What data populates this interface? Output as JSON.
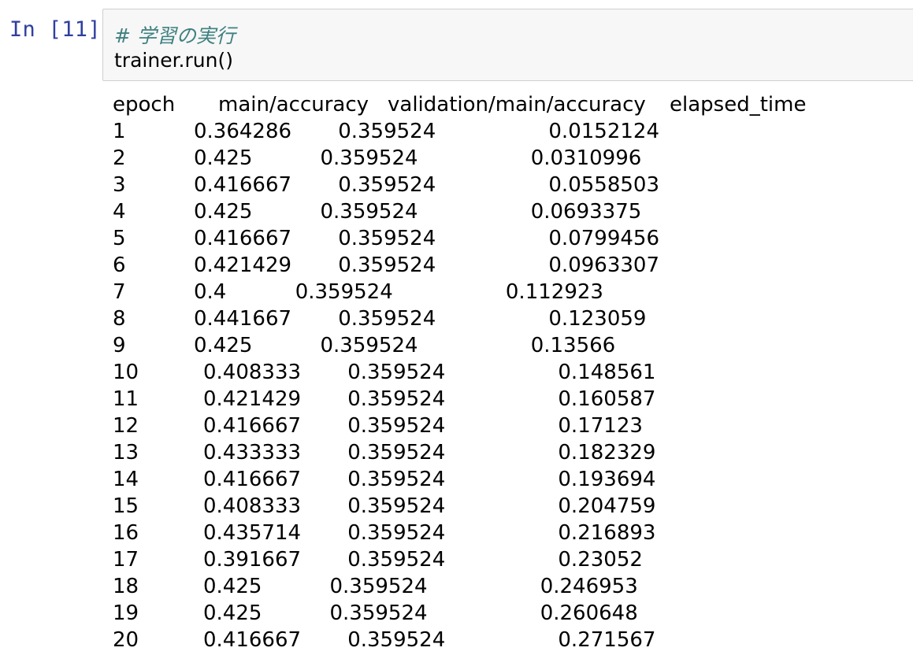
{
  "prompt": "In [11]:",
  "code": {
    "comment": "# 学習の実行",
    "line": "trainer.run()"
  },
  "output": {
    "headers": {
      "epoch": "epoch",
      "main_accuracy": "main/accuracy",
      "validation_accuracy": "validation/main/accuracy",
      "elapsed_time": "elapsed_time"
    },
    "rows": [
      {
        "epoch": "1",
        "main_accuracy": "0.364286",
        "validation_accuracy": "0.359524",
        "elapsed_time": "0.0152124"
      },
      {
        "epoch": "2",
        "main_accuracy": "0.425",
        "validation_accuracy": "0.359524",
        "elapsed_time": "0.0310996"
      },
      {
        "epoch": "3",
        "main_accuracy": "0.416667",
        "validation_accuracy": "0.359524",
        "elapsed_time": "0.0558503"
      },
      {
        "epoch": "4",
        "main_accuracy": "0.425",
        "validation_accuracy": "0.359524",
        "elapsed_time": "0.0693375"
      },
      {
        "epoch": "5",
        "main_accuracy": "0.416667",
        "validation_accuracy": "0.359524",
        "elapsed_time": "0.0799456"
      },
      {
        "epoch": "6",
        "main_accuracy": "0.421429",
        "validation_accuracy": "0.359524",
        "elapsed_time": "0.0963307"
      },
      {
        "epoch": "7",
        "main_accuracy": "0.4",
        "validation_accuracy": "0.359524",
        "elapsed_time": "0.112923"
      },
      {
        "epoch": "8",
        "main_accuracy": "0.441667",
        "validation_accuracy": "0.359524",
        "elapsed_time": "0.123059"
      },
      {
        "epoch": "9",
        "main_accuracy": "0.425",
        "validation_accuracy": "0.359524",
        "elapsed_time": "0.13566"
      },
      {
        "epoch": "10",
        "main_accuracy": "0.408333",
        "validation_accuracy": "0.359524",
        "elapsed_time": "0.148561"
      },
      {
        "epoch": "11",
        "main_accuracy": "0.421429",
        "validation_accuracy": "0.359524",
        "elapsed_time": "0.160587"
      },
      {
        "epoch": "12",
        "main_accuracy": "0.416667",
        "validation_accuracy": "0.359524",
        "elapsed_time": "0.17123"
      },
      {
        "epoch": "13",
        "main_accuracy": "0.433333",
        "validation_accuracy": "0.359524",
        "elapsed_time": "0.182329"
      },
      {
        "epoch": "14",
        "main_accuracy": "0.416667",
        "validation_accuracy": "0.359524",
        "elapsed_time": "0.193694"
      },
      {
        "epoch": "15",
        "main_accuracy": "0.408333",
        "validation_accuracy": "0.359524",
        "elapsed_time": "0.204759"
      },
      {
        "epoch": "16",
        "main_accuracy": "0.435714",
        "validation_accuracy": "0.359524",
        "elapsed_time": "0.216893"
      },
      {
        "epoch": "17",
        "main_accuracy": "0.391667",
        "validation_accuracy": "0.359524",
        "elapsed_time": "0.23052"
      },
      {
        "epoch": "18",
        "main_accuracy": "0.425",
        "validation_accuracy": "0.359524",
        "elapsed_time": "0.246953"
      },
      {
        "epoch": "19",
        "main_accuracy": "0.425",
        "validation_accuracy": "0.359524",
        "elapsed_time": "0.260648"
      },
      {
        "epoch": "20",
        "main_accuracy": "0.416667",
        "validation_accuracy": "0.359524",
        "elapsed_time": "0.271567"
      }
    ]
  }
}
